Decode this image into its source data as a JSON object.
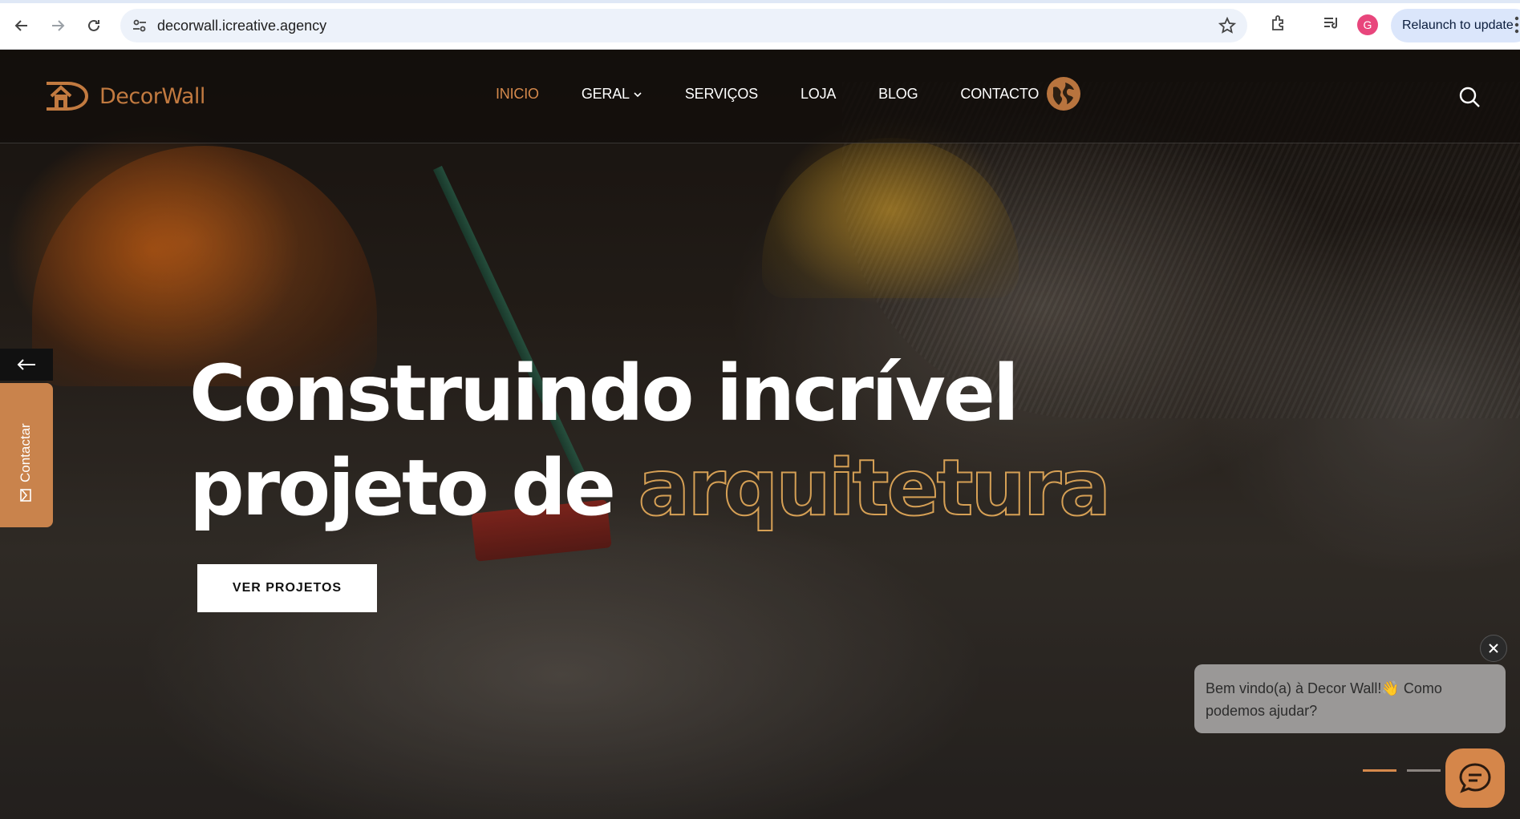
{
  "browser": {
    "url": "decorwall.icreative.agency",
    "profile_initial": "G",
    "relaunch_label": "Relaunch to update"
  },
  "header": {
    "logo_text": "DecorWall",
    "menu": [
      {
        "label": "INICIO",
        "active": true
      },
      {
        "label": "GERAL",
        "has_dropdown": true
      },
      {
        "label": "SERVIÇOS"
      },
      {
        "label": "LOJA"
      },
      {
        "label": "BLOG"
      },
      {
        "label": "CONTACTO"
      }
    ]
  },
  "side_tab": {
    "label": "Contactar"
  },
  "hero": {
    "title_line1": "Construindo incrível",
    "title_line2_plain": "projeto de ",
    "title_line2_outline": "arquitetura",
    "cta_label": "VER PROJETOS"
  },
  "chat": {
    "message": "Bem vindo(a) à Decor Wall!👋 Como podemos ajudar?"
  },
  "colors": {
    "accent": "#d5894c",
    "outline_text": "#d6a055",
    "side_tab": "#c9834c"
  },
  "icons": [
    "back-icon",
    "forward-icon",
    "reload-icon",
    "tune-icon",
    "star-icon",
    "extensions-icon",
    "media-icon",
    "kebab-icon",
    "globe-icon",
    "search-icon",
    "arrow-left-icon",
    "mail-icon",
    "close-icon",
    "chat-icon"
  ]
}
